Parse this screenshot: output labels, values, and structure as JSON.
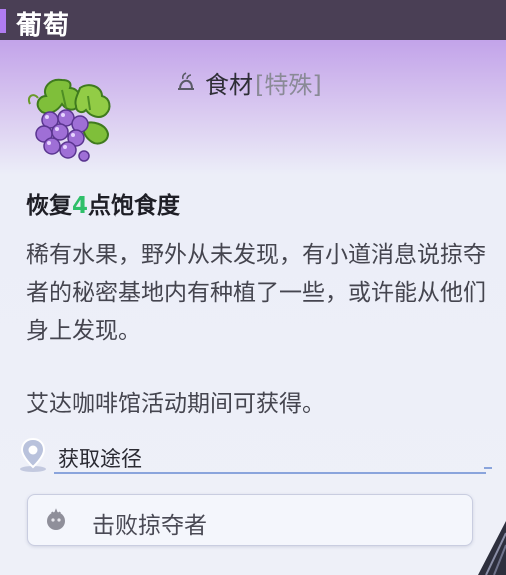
{
  "item": {
    "title": "葡萄",
    "icon": "grape-icon",
    "category_icon": "ingredient-icon",
    "category_name": "食材",
    "category_tag": "[特殊]"
  },
  "effect": {
    "prefix": "恢复",
    "value": "4",
    "suffix": "点饱食度"
  },
  "description": "稀有水果，野外从未发现，有小道消息说掠夺者的秘密基地内有种植了一些，或许能从他们身上发现。",
  "obtain_note": "艾达咖啡馆活动期间可获得。",
  "sources": {
    "header": "获取途径",
    "header_icon": "location-pin-icon",
    "items": [
      {
        "label": "击败掠夺者",
        "icon": "enemy-icon"
      }
    ]
  },
  "colors": {
    "accent_purple": "#b07cf0",
    "title_bar": "#4a3f55",
    "highlight_green": "#2fbf6a"
  }
}
